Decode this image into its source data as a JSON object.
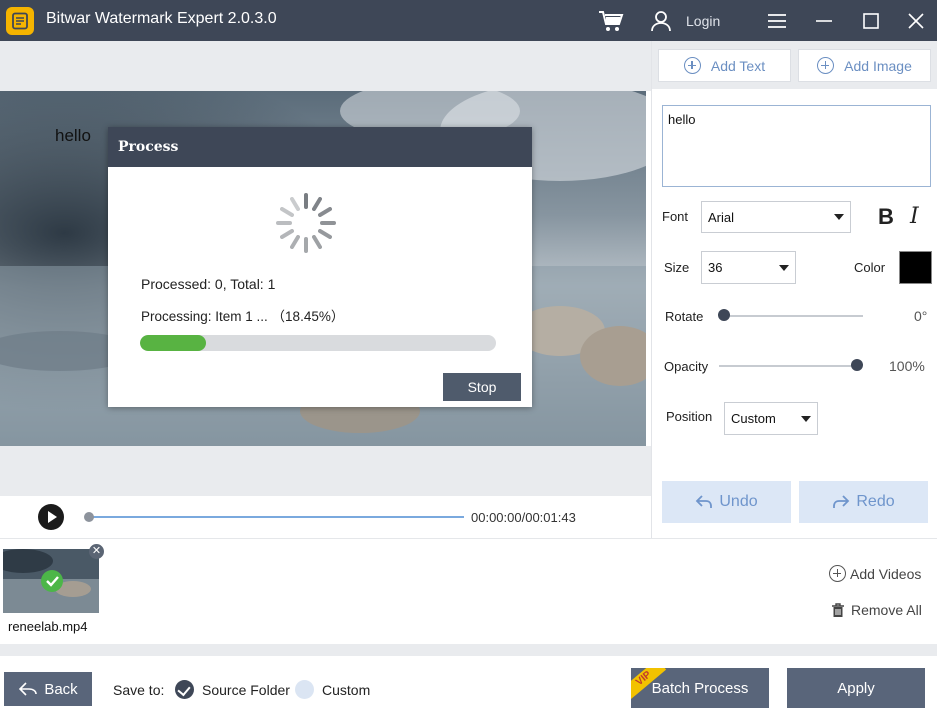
{
  "window": {
    "title": "Bitwar Watermark Expert  2.0.3.0",
    "login_label": "Login"
  },
  "preview": {
    "watermark_text": "hello"
  },
  "dialog": {
    "title": "Process",
    "processed_text": "Processed: 0, Total: 1",
    "processing_text": "Processing: Item 1 ... （18.45%）",
    "progress_fraction": 0.1845,
    "stop_label": "Stop"
  },
  "player": {
    "time": "00:00:00/00:01:43",
    "seek_fraction": 0
  },
  "toolbar": {
    "add_text_label": "Add Text",
    "add_image_label": "Add Image"
  },
  "editor": {
    "text_value": "hello",
    "font_label": "Font",
    "font_value": "Arial",
    "bold_label": "B",
    "italic_label": "I",
    "size_label": "Size",
    "size_value": "36",
    "color_label": "Color",
    "color_value": "#000000",
    "rotate_label": "Rotate",
    "rotate_value": "0°",
    "rotate_fraction": 0,
    "opacity_label": "Opacity",
    "opacity_value": "100%",
    "opacity_fraction": 1,
    "position_label": "Position",
    "position_value": "Custom",
    "undo_label": "Undo",
    "redo_label": "Redo"
  },
  "videos": {
    "items": [
      {
        "name": "reneelab.mp4",
        "status": "check-icon"
      }
    ],
    "add_label": "Add Videos",
    "remove_all_label": "Remove All"
  },
  "bottom": {
    "back_label": "Back",
    "save_to_label": "Save to:",
    "source_folder_label": "Source Folder",
    "custom_label": "Custom",
    "batch_label": "Batch Process",
    "vip_label": "VIP",
    "apply_label": "Apply"
  },
  "colors": {
    "titlebar": "#3e4757",
    "progress": "#58b342",
    "accent": "#6b8fc2"
  }
}
